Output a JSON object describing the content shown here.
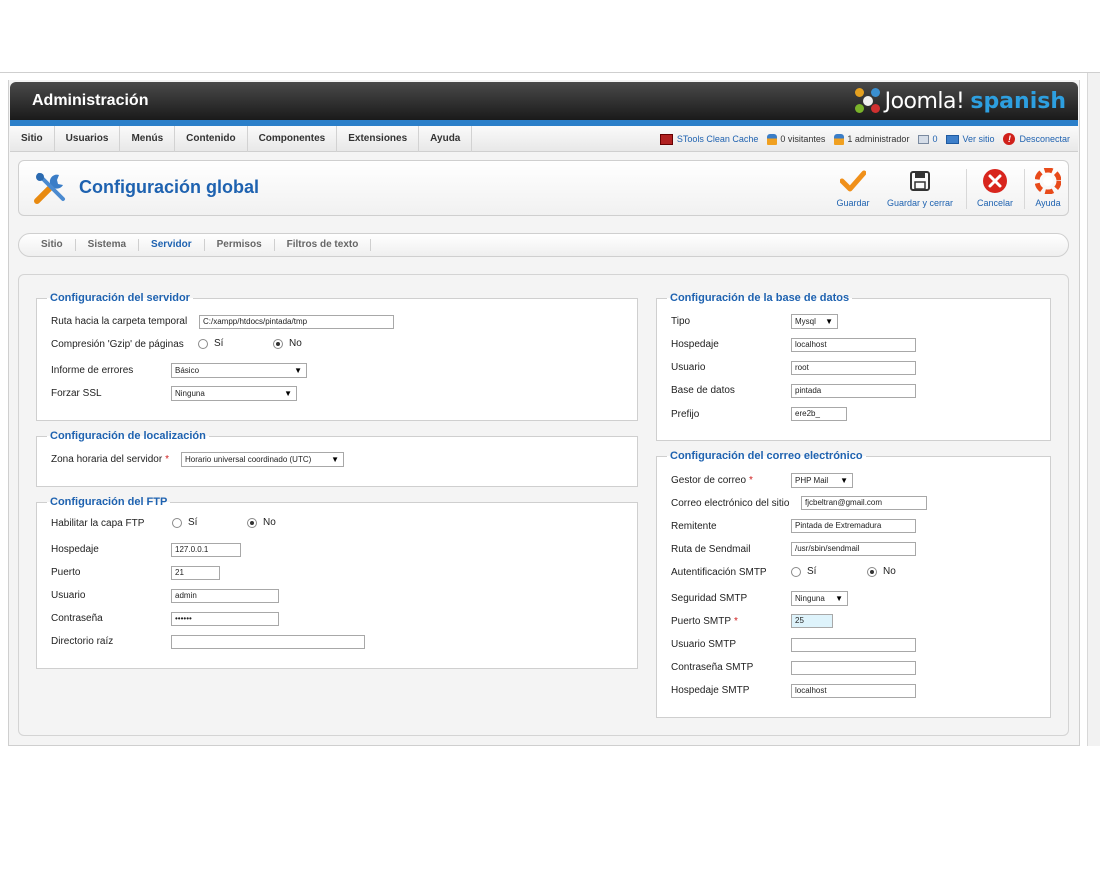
{
  "header": {
    "title": "Administración",
    "logo_joomla": "Joomla!",
    "logo_spanish": "spanish"
  },
  "menu": [
    "Sitio",
    "Usuarios",
    "Menús",
    "Contenido",
    "Componentes",
    "Extensiones",
    "Ayuda"
  ],
  "status": {
    "cache": "STools Clean Cache",
    "visitors": "0 visitantes",
    "admins": "1 administrador",
    "messages": "0",
    "view_site": "Ver sitio",
    "logout": "Desconectar"
  },
  "toolbar": {
    "page_title": "Configuración global",
    "save": "Guardar",
    "save_close": "Guardar y cerrar",
    "cancel": "Cancelar",
    "help": "Ayuda"
  },
  "tabs": [
    "Sitio",
    "Sistema",
    "Servidor",
    "Permisos",
    "Filtros de texto"
  ],
  "server": {
    "legend": "Configuración del servidor",
    "tmp_label": "Ruta hacia la carpeta temporal",
    "tmp_value": "C:/xampp/htdocs/pintada/tmp",
    "gzip_label": "Compresión 'Gzip' de páginas",
    "yes": "Sí",
    "no": "No",
    "errors_label": "Informe de errores",
    "errors_value": "Básico",
    "ssl_label": "Forzar SSL",
    "ssl_value": "Ninguna"
  },
  "locale": {
    "legend": "Configuración de localización",
    "tz_label": "Zona horaria del servidor",
    "tz_value": "Horario universal coordinado (UTC)"
  },
  "ftp": {
    "legend": "Configuración del FTP",
    "enable_label": "Habilitar la capa FTP",
    "yes": "Sí",
    "no": "No",
    "host_label": "Hospedaje",
    "host_value": "127.0.0.1",
    "port_label": "Puerto",
    "port_value": "21",
    "user_label": "Usuario",
    "user_value": "admin",
    "pass_label": "Contraseña",
    "pass_value": "••••••",
    "root_label": "Directorio raíz",
    "root_value": ""
  },
  "database": {
    "legend": "Configuración de la base de datos",
    "type_label": "Tipo",
    "type_value": "Mysql",
    "host_label": "Hospedaje",
    "host_value": "localhost",
    "user_label": "Usuario",
    "user_value": "root",
    "db_label": "Base de datos",
    "db_value": "pintada",
    "prefix_label": "Prefijo",
    "prefix_value": "ere2b_"
  },
  "mail": {
    "legend": "Configuración del correo electrónico",
    "mailer_label": "Gestor de correo",
    "mailer_value": "PHP Mail",
    "from_label": "Correo electrónico del sitio",
    "from_value": "fjcbeltran@gmail.com",
    "sender_label": "Remitente",
    "sender_value": "Pintada de Extremadura",
    "sendmail_label": "Ruta de Sendmail",
    "sendmail_value": "/usr/sbin/sendmail",
    "auth_label": "Autentificación SMTP",
    "yes": "Sí",
    "no": "No",
    "security_label": "Seguridad SMTP",
    "security_value": "Ninguna",
    "port_label": "Puerto SMTP",
    "port_value": "25",
    "smtp_user_label": "Usuario SMTP",
    "smtp_user_value": "",
    "smtp_pass_label": "Contraseña SMTP",
    "smtp_pass_value": "",
    "smtp_host_label": "Hospedaje SMTP",
    "smtp_host_value": "localhost"
  },
  "colors": {
    "accent": "#1e62b0",
    "header_dark": "#1a1a1a",
    "blue_bar": "#2b7fc9"
  },
  "icons": [
    "tools-icon",
    "check-icon",
    "save-icon",
    "cancel-icon",
    "help-icon",
    "cache-icon",
    "user-icon",
    "message-icon",
    "screen-icon",
    "power-icon"
  ]
}
